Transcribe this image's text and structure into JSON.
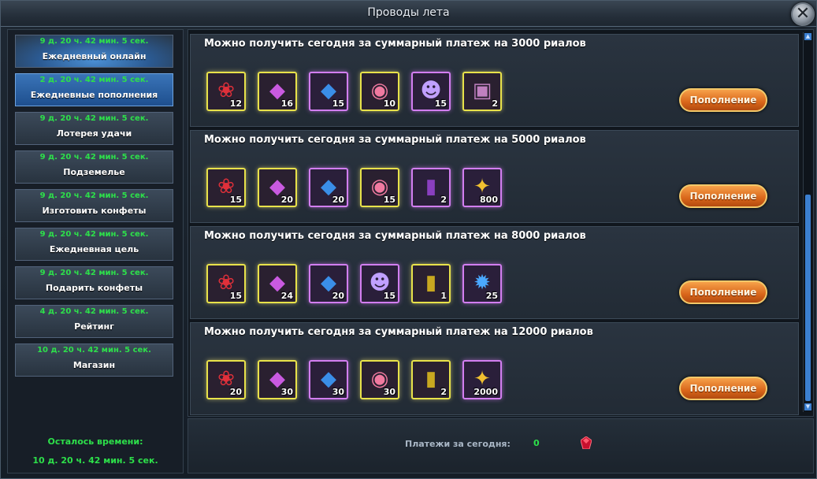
{
  "window": {
    "title": "Проводы лета",
    "close_glyph": "✕"
  },
  "sidebar": {
    "items": [
      {
        "timer": "9 д. 20 ч. 42 мин. 5 сек.",
        "label": "Ежедневный онлайн"
      },
      {
        "timer": "2 д. 20 ч. 42 мин. 5 сек.",
        "label": "Ежедневные пополнения"
      },
      {
        "timer": "9 д. 20 ч. 42 мин. 5 сек.",
        "label": "Лотерея удачи"
      },
      {
        "timer": "9 д. 20 ч. 42 мин. 5 сек.",
        "label": "Подземелье"
      },
      {
        "timer": "9 д. 20 ч. 42 мин. 5 сек.",
        "label": "Изготовить конфеты"
      },
      {
        "timer": "9 д. 20 ч. 42 мин. 5 сек.",
        "label": "Ежедневная цель"
      },
      {
        "timer": "9 д. 20 ч. 42 мин. 5 сек.",
        "label": "Подарить конфеты"
      },
      {
        "timer": "4 д. 20 ч. 42 мин. 5 сек.",
        "label": "Рейтинг"
      },
      {
        "timer": "10 д. 20 ч. 42 мин. 5 сек.",
        "label": "Магазин"
      }
    ],
    "remaining_label": "Осталось времени:",
    "remaining_time": "10 д. 20 ч. 42 мин. 5 сек."
  },
  "rewards": [
    {
      "title": "Можно получить сегодня за суммарный платеж на 3000 риалов",
      "button": "Пополнение",
      "items": [
        {
          "icon": "red-candy-pile-icon",
          "count": "12",
          "rarity": "gold"
        },
        {
          "icon": "purple-crystal-icon",
          "count": "16",
          "rarity": "gold"
        },
        {
          "icon": "blue-crystal-icon",
          "count": "15",
          "rarity": "purple"
        },
        {
          "icon": "striped-candy-icon",
          "count": "10",
          "rarity": "gold"
        },
        {
          "icon": "hero-orb-icon",
          "count": "15",
          "rarity": "purple"
        },
        {
          "icon": "gift-box-icon",
          "count": "2",
          "rarity": "gold"
        }
      ]
    },
    {
      "title": "Можно получить сегодня за суммарный платеж на 5000 риалов",
      "button": "Пополнение",
      "items": [
        {
          "icon": "red-candy-pile-icon",
          "count": "15",
          "rarity": "gold"
        },
        {
          "icon": "purple-crystal-icon",
          "count": "20",
          "rarity": "gold"
        },
        {
          "icon": "blue-crystal-icon",
          "count": "20",
          "rarity": "purple"
        },
        {
          "icon": "striped-candy-icon",
          "count": "15",
          "rarity": "gold"
        },
        {
          "icon": "purple-card-icon",
          "count": "2",
          "rarity": "purple"
        },
        {
          "icon": "gold-treasure-icon",
          "count": "800",
          "rarity": "purple"
        }
      ]
    },
    {
      "title": "Можно получить сегодня за суммарный платеж на 8000 риалов",
      "button": "Пополнение",
      "items": [
        {
          "icon": "red-candy-pile-icon",
          "count": "15",
          "rarity": "gold"
        },
        {
          "icon": "purple-crystal-icon",
          "count": "24",
          "rarity": "gold"
        },
        {
          "icon": "blue-crystal-icon",
          "count": "20",
          "rarity": "purple"
        },
        {
          "icon": "hero-orb-icon",
          "count": "15",
          "rarity": "purple"
        },
        {
          "icon": "gold-card-icon",
          "count": "1",
          "rarity": "gold"
        },
        {
          "icon": "blue-dragon-icon",
          "count": "25",
          "rarity": "purple"
        }
      ]
    },
    {
      "title": "Можно получить сегодня за суммарный платеж на 12000 риалов",
      "button": "Пополнение",
      "items": [
        {
          "icon": "red-candy-pile-icon",
          "count": "20",
          "rarity": "gold"
        },
        {
          "icon": "purple-crystal-icon",
          "count": "30",
          "rarity": "gold"
        },
        {
          "icon": "blue-crystal-icon",
          "count": "30",
          "rarity": "purple"
        },
        {
          "icon": "striped-candy-icon",
          "count": "30",
          "rarity": "gold"
        },
        {
          "icon": "gold-card-icon",
          "count": "2",
          "rarity": "gold"
        },
        {
          "icon": "gold-treasure-icon",
          "count": "2000",
          "rarity": "purple"
        }
      ]
    }
  ],
  "footer": {
    "payments_label": "Платежи за сегодня:",
    "payments_value": "0",
    "currency_icon": "red-gem-icon"
  },
  "colors": {
    "timer_green": "#2de04a",
    "active_blue": "#3a74b8",
    "button_orange": "#d9661a",
    "gold_frame": "#e8e24a",
    "purple_frame": "#d27ef0"
  },
  "glyphs": {
    "red-candy-pile-icon": "❀",
    "purple-crystal-icon": "◆",
    "blue-crystal-icon": "◆",
    "striped-candy-icon": "◉",
    "hero-orb-icon": "☻",
    "gift-box-icon": "▣",
    "purple-card-icon": "▮",
    "gold-card-icon": "▮",
    "gold-treasure-icon": "✦",
    "blue-dragon-icon": "✹"
  },
  "glyph_colors": {
    "red-candy-pile-icon": "#e0303a",
    "purple-crystal-icon": "#c95ae0",
    "blue-crystal-icon": "#3a8ee8",
    "striped-candy-icon": "#f07aa0",
    "hero-orb-icon": "#c0a0ff",
    "gift-box-icon": "#c080c0",
    "purple-card-icon": "#8a3fc0",
    "gold-card-icon": "#c8a820",
    "gold-treasure-icon": "#f0c030",
    "blue-dragon-icon": "#4aa8ff"
  }
}
